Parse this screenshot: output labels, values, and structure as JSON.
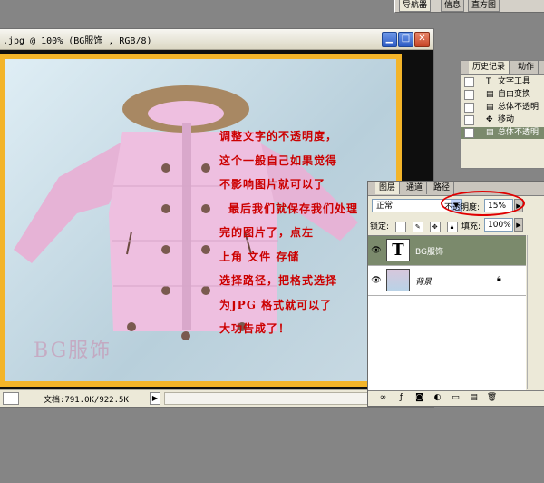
{
  "navigator": {
    "tabs": [
      "导航器",
      "信息",
      "直方图"
    ]
  },
  "document": {
    "title": ".jpg @ 100% (BG服饰 , RGB/8)",
    "instruction_lines": [
      "调整文字的不透明度，",
      "这个一般自己如果觉得",
      "不影响图片就可以了",
      "最后我们就保存我们处理",
      "完的图片了，点左",
      "上角   文件   存储",
      "选择路径，把格式选择",
      "为JPG 格式就可以了",
      "大功告成了！"
    ],
    "watermark": "BG服饰",
    "status_info": "文档:791.0K/922.5K"
  },
  "history": {
    "tabs": [
      "历史记录",
      "动作"
    ],
    "items": [
      {
        "label": "文字工具",
        "icon": "T"
      },
      {
        "label": "自由变换",
        "icon": "▤"
      },
      {
        "label": "总体不透明",
        "icon": "▤"
      },
      {
        "label": "移动",
        "icon": "✥"
      },
      {
        "label": "总体不透明",
        "icon": "▤",
        "selected": true
      }
    ]
  },
  "layers": {
    "tabs": [
      "图层",
      "通道",
      "路径"
    ],
    "blend_mode": "正常",
    "opacity_label": "不透明度:",
    "opacity_value": "15%",
    "lock_label": "锁定:",
    "fill_label": "填充:",
    "fill_value": "100%",
    "items": [
      {
        "name": "BG服饰",
        "type": "text",
        "thumb_glyph": "T",
        "selected": true
      },
      {
        "name": "背景",
        "type": "image",
        "locked": true
      }
    ]
  },
  "colors": {
    "accent_red": "#cc0000",
    "photo_border": "#f3b429",
    "selected_layer": "#7b8a6c"
  }
}
